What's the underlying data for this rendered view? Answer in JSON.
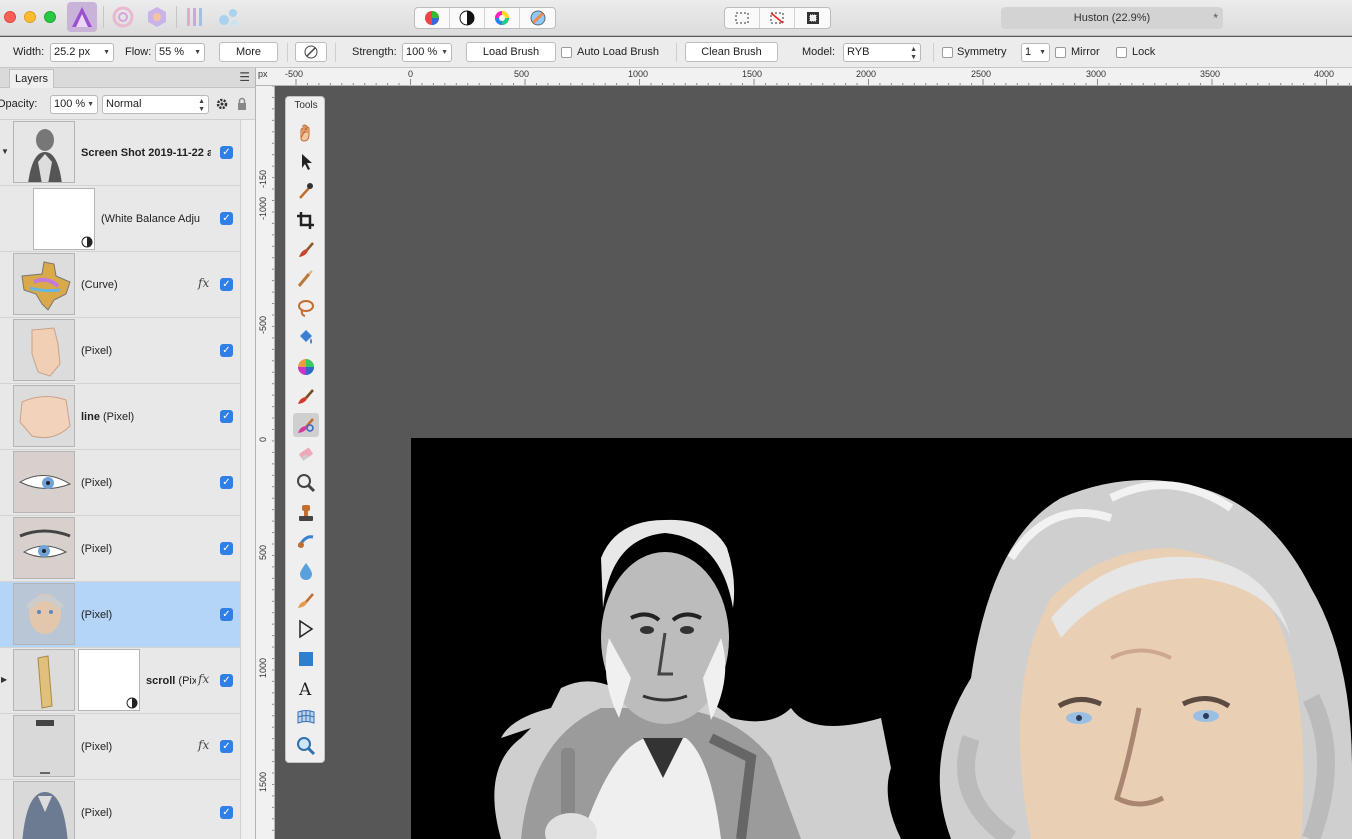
{
  "window": {
    "document_title": "Huston (22.9%)",
    "modified_marker": "*"
  },
  "context_toolbar": {
    "width_label": "Width:",
    "width_value": "25.2 px",
    "flow_label": "Flow:",
    "flow_value": "55 %",
    "more_label": "More",
    "strength_label": "Strength:",
    "strength_value": "100 %",
    "load_brush_label": "Load Brush",
    "auto_load_brush_label": "Auto Load Brush",
    "clean_brush_label": "Clean Brush",
    "model_label": "Model:",
    "model_value": "RYB",
    "symmetry_label": "Symmetry",
    "symmetry_count": "1",
    "mirror_label": "Mirror",
    "lock_label": "Lock"
  },
  "layers_panel": {
    "tab_label": "Layers",
    "opacity_label": "Opacity:",
    "opacity_value": "100 %",
    "blend_mode": "Normal",
    "layers": [
      {
        "name_bold": "Screen Shot 2019-11-22 a",
        "name": "",
        "fx": "",
        "visible": true
      },
      {
        "name_bold": "",
        "name": "(White Balance Adju",
        "fx": "",
        "visible": true
      },
      {
        "name_bold": "",
        "name": "(Curve)",
        "fx": "fx",
        "visible": true
      },
      {
        "name_bold": "",
        "name": "(Pixel)",
        "fx": "",
        "visible": true
      },
      {
        "name_bold": "line",
        "name": "(Pixel)",
        "fx": "",
        "visible": true
      },
      {
        "name_bold": "",
        "name": "(Pixel)",
        "fx": "",
        "visible": true
      },
      {
        "name_bold": "",
        "name": "(Pixel)",
        "fx": "",
        "visible": true
      },
      {
        "name_bold": "",
        "name": "(Pixel)",
        "fx": "",
        "visible": true,
        "selected": true
      },
      {
        "name_bold": "scroll",
        "name": "(Pix",
        "fx": "fx",
        "visible": true
      },
      {
        "name_bold": "",
        "name": "(Pixel)",
        "fx": "fx",
        "visible": true
      },
      {
        "name_bold": "",
        "name": "(Pixel)",
        "fx": "",
        "visible": true
      }
    ]
  },
  "rulers": {
    "unit": "px",
    "top_labels": [
      "-500",
      "0",
      "500",
      "1000",
      "1500",
      "2000",
      "2500",
      "3000",
      "3500",
      "4000"
    ],
    "left_labels": [
      "-150",
      "-1000",
      "-500",
      "0",
      "500",
      "1000",
      "1500"
    ]
  },
  "tools_panel": {
    "title": "Tools",
    "tools": [
      "hand-icon",
      "move-icon",
      "color-picker-icon",
      "crop-icon",
      "paint-mixer-icon",
      "selection-brush-icon",
      "freehand-selection-icon",
      "flood-fill-icon",
      "gradient-icon",
      "paint-brush-icon",
      "mixer-brush-icon",
      "erase-icon",
      "dodge-icon",
      "clone-icon",
      "smudge-icon",
      "blur-icon",
      "healing-icon",
      "pen-icon",
      "rectangle-icon",
      "text-icon",
      "mesh-warp-icon",
      "zoom-icon"
    ],
    "active_tool": "mixer-brush-icon"
  },
  "colors": {
    "accent": "#2f7fe6",
    "selected_row": "#b4d4f8",
    "canvas_bg": "#575757"
  }
}
